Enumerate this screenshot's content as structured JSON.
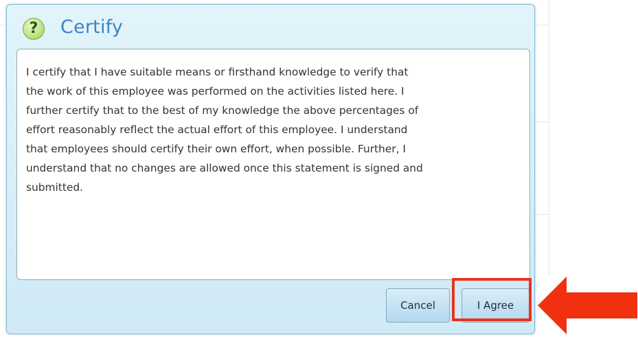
{
  "dialog": {
    "title": "Certify",
    "help_icon_glyph": "?",
    "statement": " I certify that I have suitable means or firsthand knowledge to verify that\nthe work of this employee was performed on the activities listed here.  I\nfurther certify that to the best of my knowledge the above percentages of\neffort reasonably reflect the actual effort of this employee. I understand\nthat employees should certify their own effort, when possible.  Further, I\nunderstand that no changes are allowed once this statement is signed and\nsubmitted.",
    "buttons": {
      "cancel_label": "Cancel",
      "agree_label": "I Agree"
    }
  },
  "annotation": {
    "highlight_color": "#e8321e",
    "arrow_color": "#f0300f",
    "arrow_icon": "left-arrow-icon"
  },
  "colors": {
    "title": "#3a86c2",
    "dialog_bg": "#d9eff9",
    "button_bg": "#c6e3f4"
  }
}
